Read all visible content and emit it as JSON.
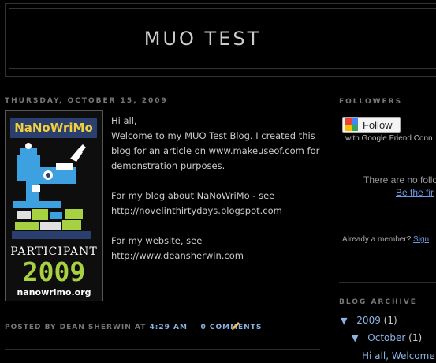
{
  "blog": {
    "title": "MUO TEST"
  },
  "post": {
    "date": "Thursday, October 15, 2009",
    "paragraphs": [
      "Hi all,\nWelcome to my MUO Test Blog. I created this blog for an article on www.makeuseof.com for demonstration purposes.",
      "For my blog about NaNoWriMo - see\nhttp://novelinthirtydays.blogspot.com",
      "For my website, see\nhttp://www.deansherwin.com"
    ],
    "footer": {
      "posted_by": "Posted by Dean Sherwin at",
      "time": "4:29 AM",
      "comments": "0 comments"
    },
    "badge": {
      "title": "NaNoWriMo",
      "participant": "PARTICIPANT",
      "year": "2009",
      "url": "nanowrimo.org"
    }
  },
  "sidebar": {
    "followers": {
      "heading": "Followers",
      "button_label": "Follow",
      "gfc_text": "with Google Friend Conn",
      "empty_text": "There are no follo",
      "be_first": "Be the fir",
      "member_text": "Already a member?",
      "sign_in": "Sign"
    },
    "archive": {
      "heading": "Blog Archive",
      "year": "2009",
      "year_count": "(1)",
      "month": "October",
      "month_count": "(1)",
      "post_title": "Hi all, Welcome"
    }
  },
  "colors": {
    "background": "#000000",
    "link": "#8bb4e6",
    "muted": "#777777",
    "badge_green": "#a7d141"
  }
}
